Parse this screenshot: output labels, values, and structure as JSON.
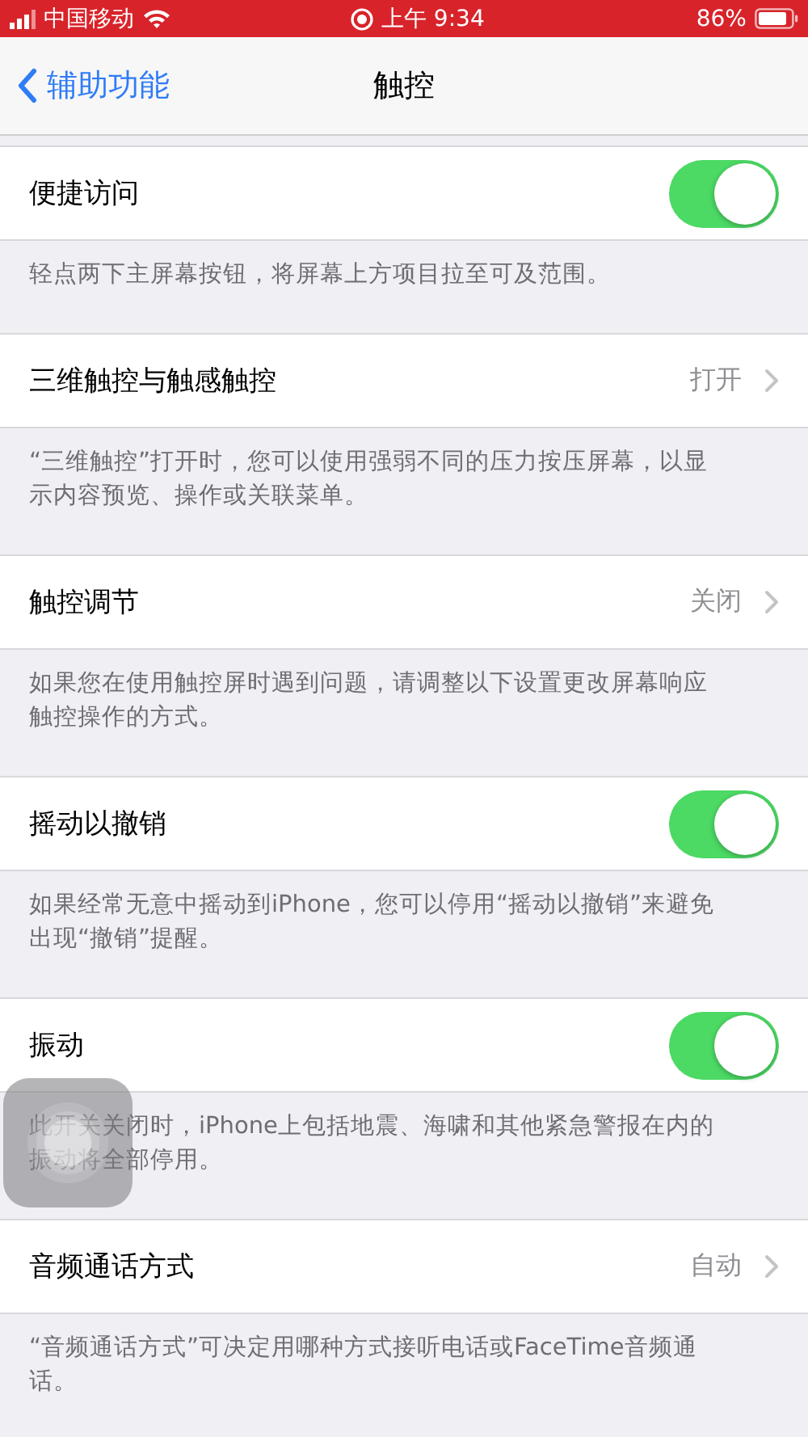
{
  "status_bar": {
    "carrier": "中国移动",
    "time": "上午 9:34",
    "battery": "86%"
  },
  "nav": {
    "back": "辅助功能",
    "title": "触控"
  },
  "sections": [
    {
      "kind": "toggle",
      "label": "便捷访问",
      "on": true,
      "footer": "轻点两下主屏幕按钮，将屏幕上方项目拉至可及范围。"
    },
    {
      "kind": "link",
      "label": "三维触控与触感触控",
      "value": "打开",
      "footer": "“三维触控”打开时，您可以使用强弱不同的压力按压屏幕，以显示内容预览、操作或关联菜单。"
    },
    {
      "kind": "link",
      "label": "触控调节",
      "value": "关闭",
      "footer": "如果您在使用触控屏时遇到问题，请调整以下设置更改屏幕响应触控操作的方式。"
    },
    {
      "kind": "toggle",
      "label": "摇动以撤销",
      "on": true,
      "footer": "如果经常无意中摇动到iPhone，您可以停用“摇动以撤销”来避免出现“撤销”提醒。"
    },
    {
      "kind": "toggle",
      "label": "振动",
      "on": true,
      "footer": "此开关关闭时，iPhone上包括地震、海啸和其他紧急警报在内的振动将全部停用。"
    },
    {
      "kind": "link",
      "label": "音频通话方式",
      "value": "自动",
      "footer": "“音频通话方式”可决定用哪种方式接听电话或FaceTime音频通话。"
    }
  ]
}
